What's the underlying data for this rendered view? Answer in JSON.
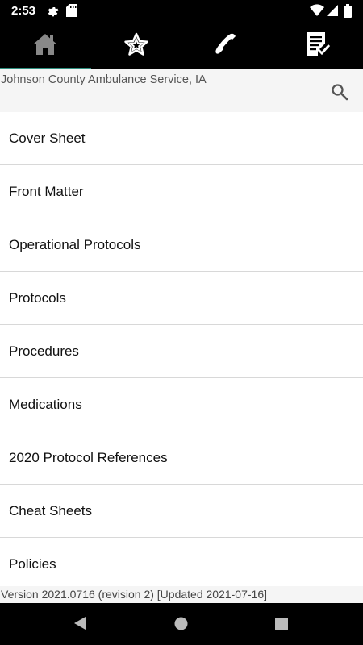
{
  "status": {
    "time": "2:53"
  },
  "header": {
    "title": "Johnson County Ambulance Service, IA"
  },
  "menu": {
    "items": [
      {
        "label": "Cover Sheet"
      },
      {
        "label": "Front Matter"
      },
      {
        "label": "Operational Protocols"
      },
      {
        "label": "Protocols"
      },
      {
        "label": "Procedures"
      },
      {
        "label": "Medications"
      },
      {
        "label": "2020 Protocol References"
      },
      {
        "label": "Cheat Sheets"
      },
      {
        "label": "Policies"
      }
    ]
  },
  "footer": {
    "version": "Version 2021.0716 (revision 2) [Updated 2021-07-16]"
  },
  "tabs": [
    {
      "icon": "home-icon"
    },
    {
      "icon": "star-icon"
    },
    {
      "icon": "phone-icon"
    },
    {
      "icon": "checklist-icon"
    }
  ],
  "colors": {
    "tab_underline": "#2e8f7f",
    "header_bg": "#f5f5f5"
  }
}
